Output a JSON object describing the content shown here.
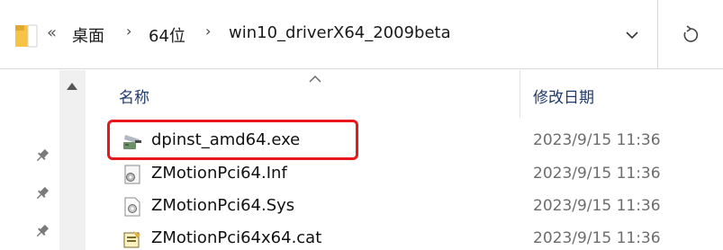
{
  "breadcrumb": {
    "overflow": "«",
    "items": [
      "桌面",
      "64位",
      "win10_driverX64_2009beta"
    ],
    "separator": "›"
  },
  "columns": {
    "name": "名称",
    "date_modified": "修改日期"
  },
  "files": [
    {
      "name": "dpinst_amd64.exe",
      "date": "2023/9/15 11:36",
      "icon": "installer-icon",
      "highlighted": true
    },
    {
      "name": "ZMotionPci64.Inf",
      "date": "2023/9/15 11:36",
      "icon": "inf-settings-icon",
      "highlighted": false
    },
    {
      "name": "ZMotionPci64.Sys",
      "date": "2023/9/15 11:36",
      "icon": "system-file-icon",
      "highlighted": false
    },
    {
      "name": "ZMotionPci64x64.cat",
      "date": "2023/9/15 11:36",
      "icon": "catalog-icon",
      "highlighted": false
    }
  ],
  "colors": {
    "highlight": "#e8171c",
    "header_text": "#1e3a6e",
    "date_text": "#6d6d6d",
    "folder": "#f6c344"
  }
}
